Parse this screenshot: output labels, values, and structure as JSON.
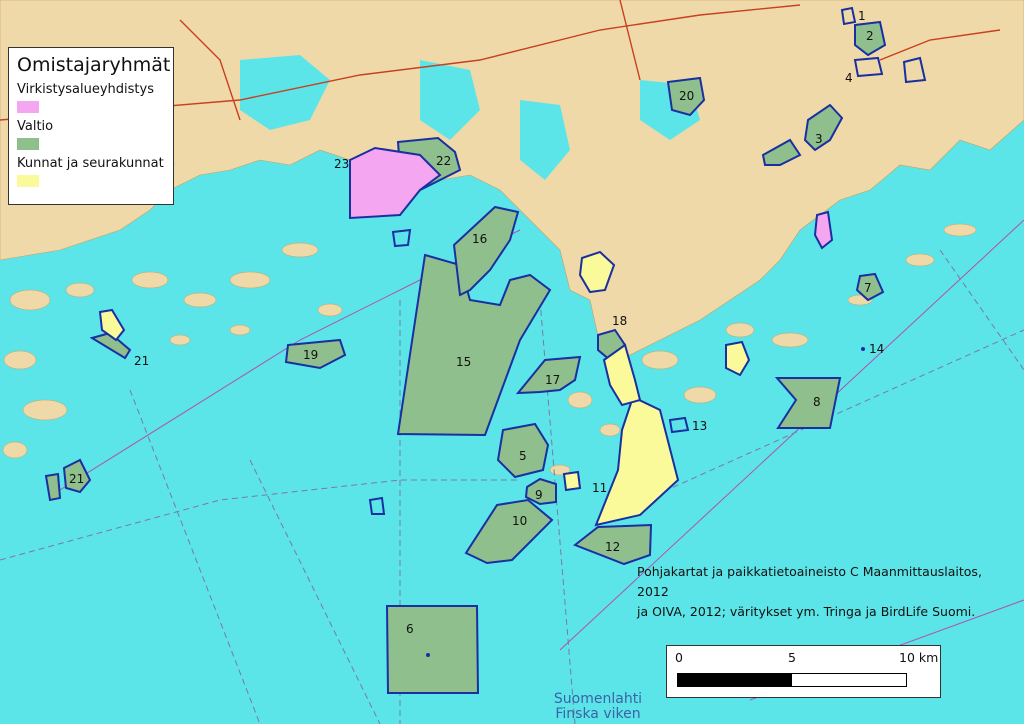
{
  "legend": {
    "title": "Omistajaryhmät",
    "items": [
      {
        "label": "Virkistysalueyhdistys",
        "color": "#f4a6f0"
      },
      {
        "label": "Valtio",
        "color": "#8fbf8c"
      },
      {
        "label": "Kunnat ja seurakunnat",
        "color": "#fafa9a"
      }
    ]
  },
  "credit": {
    "line1": "Pohjakartat ja paikkatietoaineisto C Maanmittauslaitos, 2012",
    "line2": "ja OIVA, 2012; väritykset ym. Tringa ja BirdLife Suomi."
  },
  "scale_bar": {
    "label_0": "0",
    "label_mid": "5",
    "label_end": "10 km"
  },
  "sea_label": {
    "line1": "Suomenlahti",
    "line2": "Finska viken"
  },
  "area_numbers": [
    "1",
    "2",
    "3",
    "4",
    "5",
    "6",
    "7",
    "8",
    "9",
    "10",
    "11",
    "12",
    "13",
    "14",
    "15",
    "16",
    "17",
    "18",
    "19",
    "20",
    "21",
    "21",
    "22",
    "23"
  ],
  "colors": {
    "sea": "#5ce5e8",
    "land": "#f0d9a8",
    "area_outline": "#1a2fa0"
  }
}
